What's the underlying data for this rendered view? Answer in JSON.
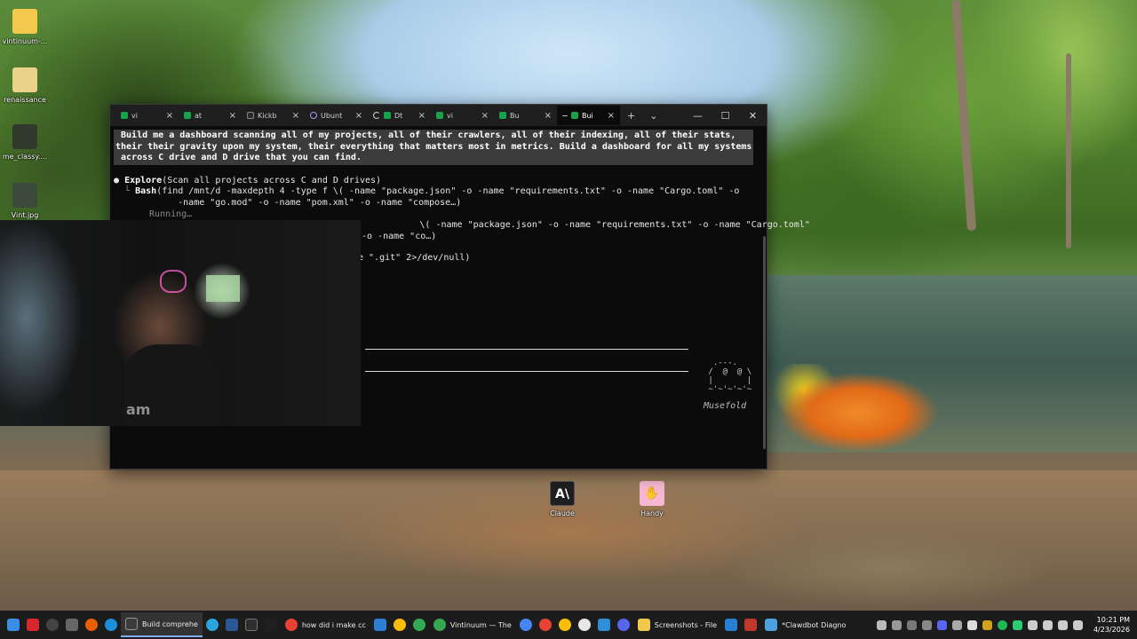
{
  "desktop_icons": [
    {
      "label": "vintinuum-...",
      "color": "#f2c94c"
    },
    {
      "label": "renaissance",
      "color": "#e9d28a"
    },
    {
      "label": "me_classy....",
      "color": "#2f3a2c"
    },
    {
      "label": "Vint.jpg",
      "color": "#3b4a3a"
    }
  ],
  "desktop_shortcuts": [
    {
      "label": "Claude",
      "glyph": "A\\",
      "color": "#1f1f1f"
    },
    {
      "label": "Handy",
      "glyph": "✋",
      "color": "#f5b8d0"
    }
  ],
  "terminal": {
    "tabs": [
      {
        "label": "vi",
        "icon": "terminal-icon"
      },
      {
        "label": "at",
        "icon": "terminal-icon"
      },
      {
        "label": "Kickb",
        "icon": "terminal-dark-icon"
      },
      {
        "label": "Ubunt",
        "icon": "ubuntu-icon"
      },
      {
        "label": "Dt",
        "icon": "loading-icon"
      },
      {
        "label": "vi",
        "icon": "terminal-icon"
      },
      {
        "label": "Bu",
        "icon": "terminal-icon"
      },
      {
        "label": "Bui",
        "icon": "terminal-icon",
        "active": true
      }
    ],
    "new_tab": "+",
    "dropdown": "⌄",
    "prompt_lines": [
      " Build me a dashboard scanning all of my projects, all of their crawlers, all of their indexing, all of their stats,",
      "their their gravity upon my system, their everything that matters most in metrics. Build a dashboard for all my systems",
      " across C drive and D drive that you can find."
    ],
    "explore_bullet": "●",
    "explore_name": "Explore",
    "explore_args": "(Scan all projects across C and D drives)",
    "bash1_prefix": "  └ ",
    "bash1_name": "Bash",
    "bash1_args": "(find /mnt/d -maxdepth 4 -type f \\( -name \"package.json\" -o -name \"requirements.txt\" -o -name \"Cargo.toml\" -o",
    "bash1_cont": "       -name \"go.mod\" -o -name \"pom.xml\" -o -name \"compose…)",
    "running": "  Running…",
    "bash2_partial": "                   \\( -name \"package.json\" -o -name \"requirements.txt\" -o -name \"Cargo.toml\"",
    "bash2_cont": "-o -name \"co…)",
    "bash3_partial": "e \".git\" 2>/dev/null)",
    "mascot_art": "  .---.\n /  @  @ \\\n |       |\n ~'~'~'~'~",
    "mascot_name": "Musefold"
  },
  "webcam": {
    "shirt_text": "am"
  },
  "taskbar": {
    "apps": [
      {
        "label": "Build comprehe",
        "icon": "terminal-icon",
        "color": "#3b3b3b",
        "active": true
      },
      {
        "label": "how did i make cc",
        "icon": "chrome-icon",
        "color": "#e94235"
      },
      {
        "label": "Vintinuum — The",
        "icon": "chrome-icon",
        "color": "#34a853"
      },
      {
        "label": "Screenshots - File",
        "icon": "folder-icon",
        "color": "#f2c94c"
      },
      {
        "label": "*Clawdbot Diagno",
        "icon": "notepad-icon",
        "color": "#4aa3df"
      }
    ],
    "clock_time": "10:21 PM",
    "clock_date": "4/23/2026"
  }
}
